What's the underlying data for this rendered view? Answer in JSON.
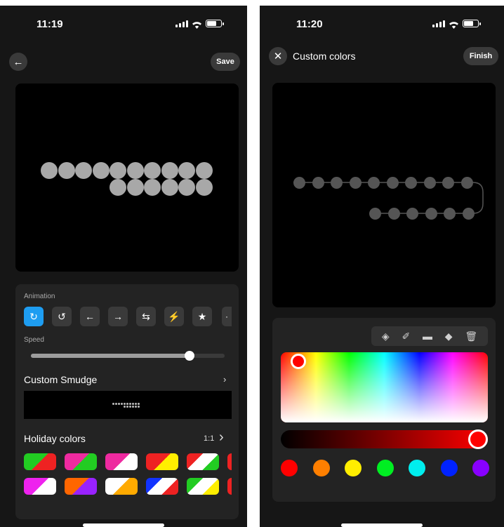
{
  "left": {
    "status": {
      "time": "11:19"
    },
    "header": {
      "back_icon": "arrow-left-icon",
      "save_label": "Save"
    },
    "animation": {
      "label": "Animation",
      "buttons": [
        {
          "icon": "rotate-cw-icon",
          "glyph": "↻",
          "active": true
        },
        {
          "icon": "rotate-ccw-icon",
          "glyph": "↺",
          "active": false
        },
        {
          "icon": "arrow-left-icon",
          "glyph": "←",
          "active": false
        },
        {
          "icon": "arrow-right-icon",
          "glyph": "→",
          "active": false
        },
        {
          "icon": "swap-arrows-icon",
          "glyph": "⇆",
          "active": false
        },
        {
          "icon": "lightning-icon",
          "glyph": "⚡",
          "active": false
        },
        {
          "icon": "star-icon",
          "glyph": "★",
          "active": false
        }
      ]
    },
    "speed": {
      "label": "Speed",
      "value_fraction": 0.82
    },
    "custom_smudge": {
      "label": "Custom Smudge"
    },
    "holiday": {
      "label": "Holiday colors",
      "ratio": "1:1",
      "swatches_row1": [
        [
          "#22cc22",
          "#ee2222"
        ],
        [
          "#ee2aa0",
          "#22cc22"
        ],
        [
          "#ee2aa0",
          "#ffffff"
        ],
        [
          "#ee2222",
          "#ffee00"
        ],
        [
          "#ee2222",
          "#ffffff",
          "#22cc22"
        ]
      ],
      "swatches_row2": [
        [
          "#ee22ee",
          "#ffffff"
        ],
        [
          "#ff6600",
          "#9922ff"
        ],
        [
          "#ffffff",
          "#ffaa00"
        ],
        [
          "#1133ff",
          "#ffffff",
          "#ee2222"
        ],
        [
          "#22cc22",
          "#ffffff",
          "#ffee00"
        ]
      ]
    }
  },
  "right": {
    "status": {
      "time": "11:20"
    },
    "header": {
      "close_icon": "close-icon",
      "title": "Custom colors",
      "finish_label": "Finish"
    },
    "tools": [
      {
        "icon": "paint-bucket-icon",
        "glyph": "◈"
      },
      {
        "icon": "brush-icon",
        "glyph": "✐"
      },
      {
        "icon": "pill-shape-icon",
        "glyph": "▬"
      },
      {
        "icon": "eraser-icon",
        "glyph": "◆"
      },
      {
        "icon": "trash-icon",
        "glyph": "🗑"
      }
    ],
    "selected_color": "#ff0000",
    "presets": [
      "#ff0000",
      "#ff7f00",
      "#ffee00",
      "#00ee22",
      "#00eeee",
      "#0022ff",
      "#8800ff"
    ]
  }
}
